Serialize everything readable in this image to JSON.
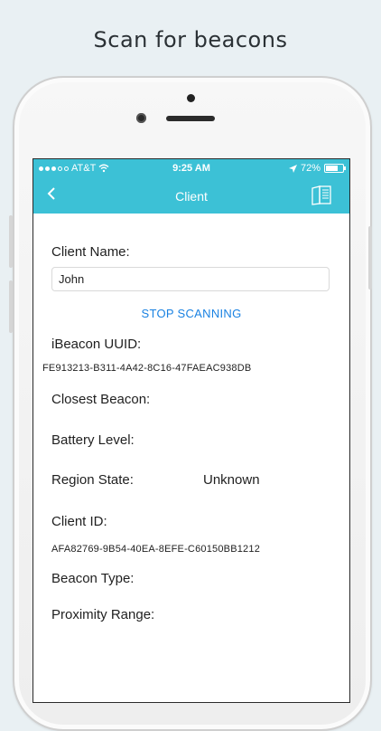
{
  "promo": {
    "title": "Scan for beacons"
  },
  "status_bar": {
    "carrier": "AT&T",
    "time": "9:25 AM",
    "battery_percent": "72%",
    "battery_level": 0.72
  },
  "nav": {
    "title": "Client"
  },
  "form": {
    "client_name_label": "Client Name:",
    "client_name_value": "John",
    "stop_scanning_label": "STOP SCANNING",
    "ibeacon_uuid_label": "iBeacon UUID:",
    "ibeacon_uuid_value": "FE913213-B311-4A42-8C16-47FAEAC938DB",
    "closest_beacon_label": "Closest Beacon:",
    "battery_level_label": "Battery Level:",
    "region_state_label": "Region State:",
    "region_state_value": "Unknown",
    "client_id_label": "Client ID:",
    "client_id_value": "AFA82769-9B54-40EA-8EFE-C60150BB1212",
    "beacon_type_label": "Beacon Type:",
    "proximity_range_label": "Proximity Range:"
  },
  "colors": {
    "accent": "#3cc1d6",
    "link": "#1a82e2"
  }
}
